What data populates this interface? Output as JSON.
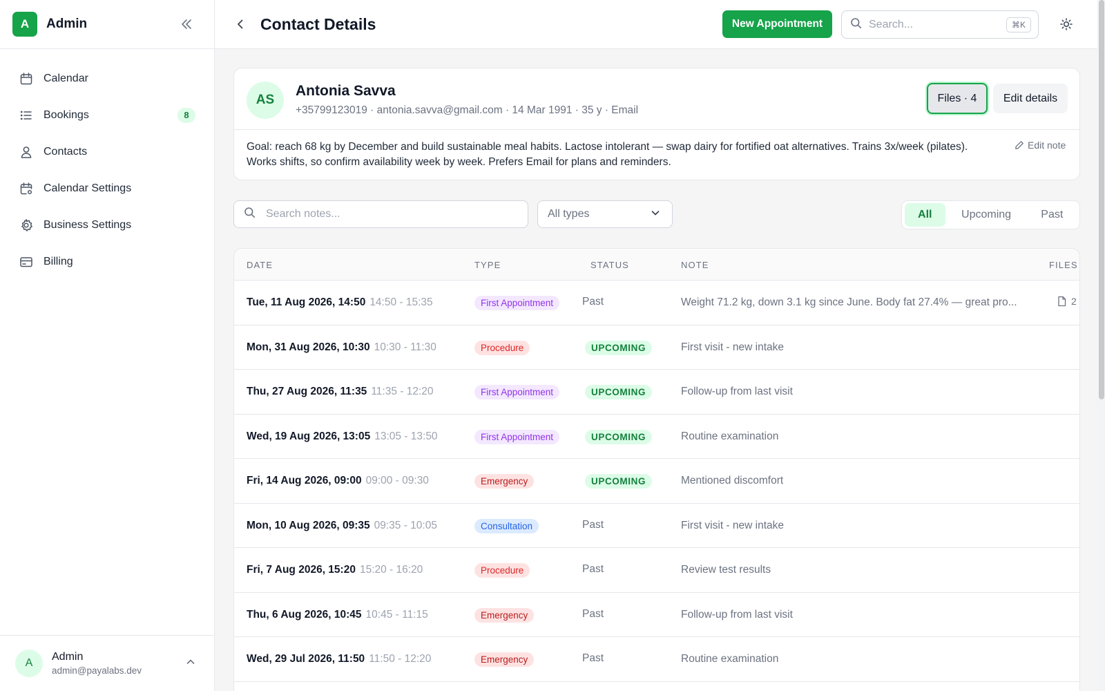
{
  "sidebar": {
    "logo_letter": "A",
    "title": "Admin",
    "items": [
      {
        "label": "Calendar",
        "icon": "calendar-icon"
      },
      {
        "label": "Bookings",
        "icon": "list-icon",
        "badge": "8"
      },
      {
        "label": "Contacts",
        "icon": "user-icon"
      },
      {
        "label": "Calendar Settings",
        "icon": "calendar-settings-icon"
      },
      {
        "label": "Business Settings",
        "icon": "gear-icon"
      },
      {
        "label": "Billing",
        "icon": "credit-card-icon"
      }
    ],
    "user": {
      "initial": "A",
      "name": "Admin",
      "email": "admin@payalabs.dev"
    }
  },
  "topbar": {
    "title": "Contact Details",
    "new_appointment": "New Appointment",
    "search_placeholder": "Search...",
    "shortcut": "⌘K"
  },
  "contact": {
    "initials": "AS",
    "name": "Antonia Savva",
    "meta": "+35799123019 · antonia.savva@gmail.com · 14 Mar 1991 · 35 y · Email",
    "files_button": "Files · 4",
    "edit_button": "Edit details",
    "note": "Goal: reach 68 kg by December and build sustainable meal habits. Lactose intolerant — swap dairy for fortified oat alternatives. Trains 3x/week (pilates). Works shifts, so confirm availability week by week. Prefers Email for plans and reminders.",
    "edit_note": "Edit note"
  },
  "filters": {
    "search_placeholder": "Search notes...",
    "type_select": "All types",
    "tabs": [
      "All",
      "Upcoming",
      "Past"
    ],
    "active_tab": "All"
  },
  "table": {
    "headers": {
      "date": "DATE",
      "type": "TYPE",
      "status": "STATUS",
      "note": "NOTE",
      "files": "FILES"
    },
    "rows": [
      {
        "date": "Tue, 11 Aug 2026, 14:50",
        "range": "14:50 - 15:35",
        "type": "First Appointment",
        "status": "Past",
        "note": "Weight 71.2 kg, down 3.1 kg since June. Body fat 27.4% — great pro...",
        "files": "2"
      },
      {
        "date": "Mon, 31 Aug 2026, 10:30",
        "range": "10:30 - 11:30",
        "type": "Procedure",
        "status": "UPCOMING",
        "note": "First visit - new intake",
        "files": ""
      },
      {
        "date": "Thu, 27 Aug 2026, 11:35",
        "range": "11:35 - 12:20",
        "type": "First Appointment",
        "status": "UPCOMING",
        "note": "Follow-up from last visit",
        "files": ""
      },
      {
        "date": "Wed, 19 Aug 2026, 13:05",
        "range": "13:05 - 13:50",
        "type": "First Appointment",
        "status": "UPCOMING",
        "note": "Routine examination",
        "files": ""
      },
      {
        "date": "Fri, 14 Aug 2026, 09:00",
        "range": "09:00 - 09:30",
        "type": "Emergency",
        "status": "UPCOMING",
        "note": "Mentioned discomfort",
        "files": ""
      },
      {
        "date": "Mon, 10 Aug 2026, 09:35",
        "range": "09:35 - 10:05",
        "type": "Consultation",
        "status": "Past",
        "note": "First visit - new intake",
        "files": ""
      },
      {
        "date": "Fri, 7 Aug 2026, 15:20",
        "range": "15:20 - 16:20",
        "type": "Procedure",
        "status": "Past",
        "note": "Review test results",
        "files": ""
      },
      {
        "date": "Thu, 6 Aug 2026, 10:45",
        "range": "10:45 - 11:15",
        "type": "Emergency",
        "status": "Past",
        "note": "Follow-up from last visit",
        "files": ""
      },
      {
        "date": "Wed, 29 Jul 2026, 11:50",
        "range": "11:50 - 12:20",
        "type": "Emergency",
        "status": "Past",
        "note": "Routine examination",
        "files": ""
      }
    ]
  },
  "colors": {
    "accent": "#16a34a",
    "types": {
      "First Appointment": {
        "bg": "#f3e8ff",
        "fg": "#9333ea"
      },
      "Procedure": {
        "bg": "#fee2e2",
        "fg": "#dc2626"
      },
      "Emergency": {
        "bg": "#fee2e2",
        "fg": "#b91c1c"
      },
      "Consultation": {
        "bg": "#dbeafe",
        "fg": "#2563eb"
      }
    }
  }
}
